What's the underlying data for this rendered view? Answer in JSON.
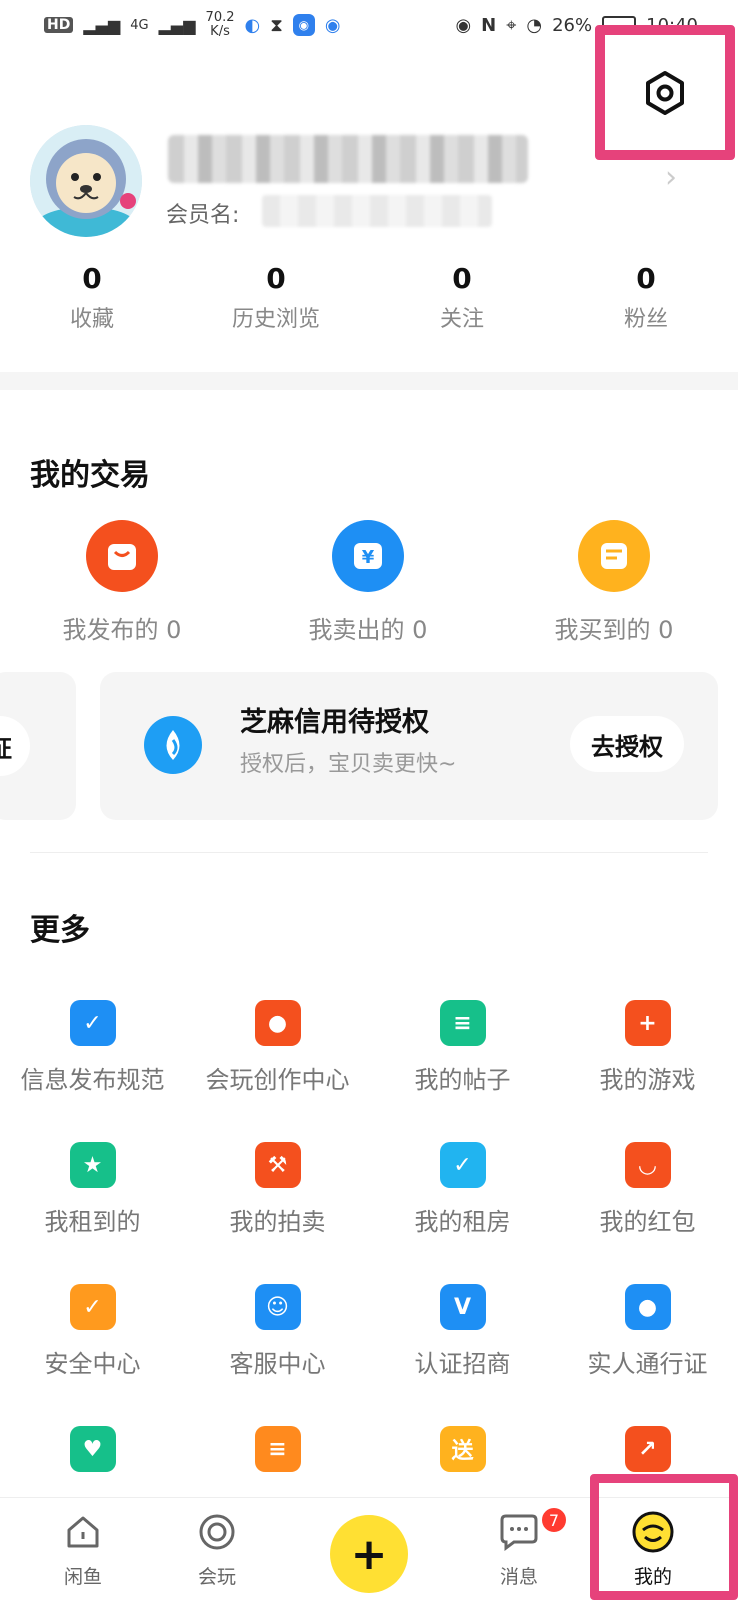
{
  "status_bar": {
    "left_text": "HD",
    "signal": "4G",
    "speed_value": "70.2",
    "speed_unit": "K/s",
    "battery": "26%",
    "time": "10:40"
  },
  "profile": {
    "member_label": "会员名:",
    "stats": [
      {
        "num": "0",
        "label": "收藏"
      },
      {
        "num": "0",
        "label": "历史浏览"
      },
      {
        "num": "0",
        "label": "关注"
      },
      {
        "num": "0",
        "label": "粉丝"
      }
    ]
  },
  "trade": {
    "title": "我的交易",
    "items": [
      {
        "label": "我发布的 0",
        "icon": "bag-icon",
        "color": "#f4501e"
      },
      {
        "label": "我卖出的 0",
        "icon": "yen-icon",
        "color": "#1e8ff4"
      },
      {
        "label": "我买到的 0",
        "icon": "receipt-icon",
        "color": "#ffb21e"
      }
    ]
  },
  "cards": {
    "left_pill": "证",
    "zhima_title": "芝麻信用待授权",
    "zhima_sub": "授权后，宝贝卖更快~",
    "zhima_button": "去授权"
  },
  "more": {
    "title": "更多",
    "items": [
      {
        "label": "信息发布规范",
        "icon": "check-shield-icon",
        "color": "#1e8ff4",
        "glyph": "✓"
      },
      {
        "label": "会玩创作中心",
        "icon": "bulb-icon",
        "color": "#f4501e",
        "glyph": "●"
      },
      {
        "label": "我的帖子",
        "icon": "post-icon",
        "color": "#16c08a",
        "glyph": "≡"
      },
      {
        "label": "我的游戏",
        "icon": "gamepad-icon",
        "color": "#f4501e",
        "glyph": "+"
      },
      {
        "label": "我租到的",
        "icon": "star-icon",
        "color": "#16c08a",
        "glyph": "★"
      },
      {
        "label": "我的拍卖",
        "icon": "gavel-icon",
        "color": "#f4501e",
        "glyph": "⚒"
      },
      {
        "label": "我的租房",
        "icon": "house-icon",
        "color": "#21b4f0",
        "glyph": "✓"
      },
      {
        "label": "我的红包",
        "icon": "red-packet-icon",
        "color": "#f4501e",
        "glyph": "◡"
      },
      {
        "label": "安全中心",
        "icon": "shield-icon",
        "color": "#ff9a1e",
        "glyph": "✓"
      },
      {
        "label": "客服中心",
        "icon": "headset-icon",
        "color": "#1e8ff4",
        "glyph": "☺"
      },
      {
        "label": "认证招商",
        "icon": "v-icon",
        "color": "#1e8ff4",
        "glyph": "V"
      },
      {
        "label": "实人通行证",
        "icon": "person-icon",
        "color": "#1e8ff4",
        "glyph": "●"
      },
      {
        "label": "",
        "icon": "heart-icon",
        "color": "#16c08a",
        "glyph": "♥"
      },
      {
        "label": "",
        "icon": "card-icon",
        "color": "#ff8a1e",
        "glyph": "≡"
      },
      {
        "label": "",
        "icon": "gift-send-icon",
        "color": "#ffb21e",
        "glyph": "送"
      },
      {
        "label": "",
        "icon": "trend-icon",
        "color": "#f4501e",
        "glyph": "↗"
      }
    ]
  },
  "tabbar": {
    "tabs": [
      {
        "label": "闲鱼"
      },
      {
        "label": "会玩"
      },
      {
        "label": "消息",
        "badge": "7"
      },
      {
        "label": "我的"
      }
    ]
  }
}
